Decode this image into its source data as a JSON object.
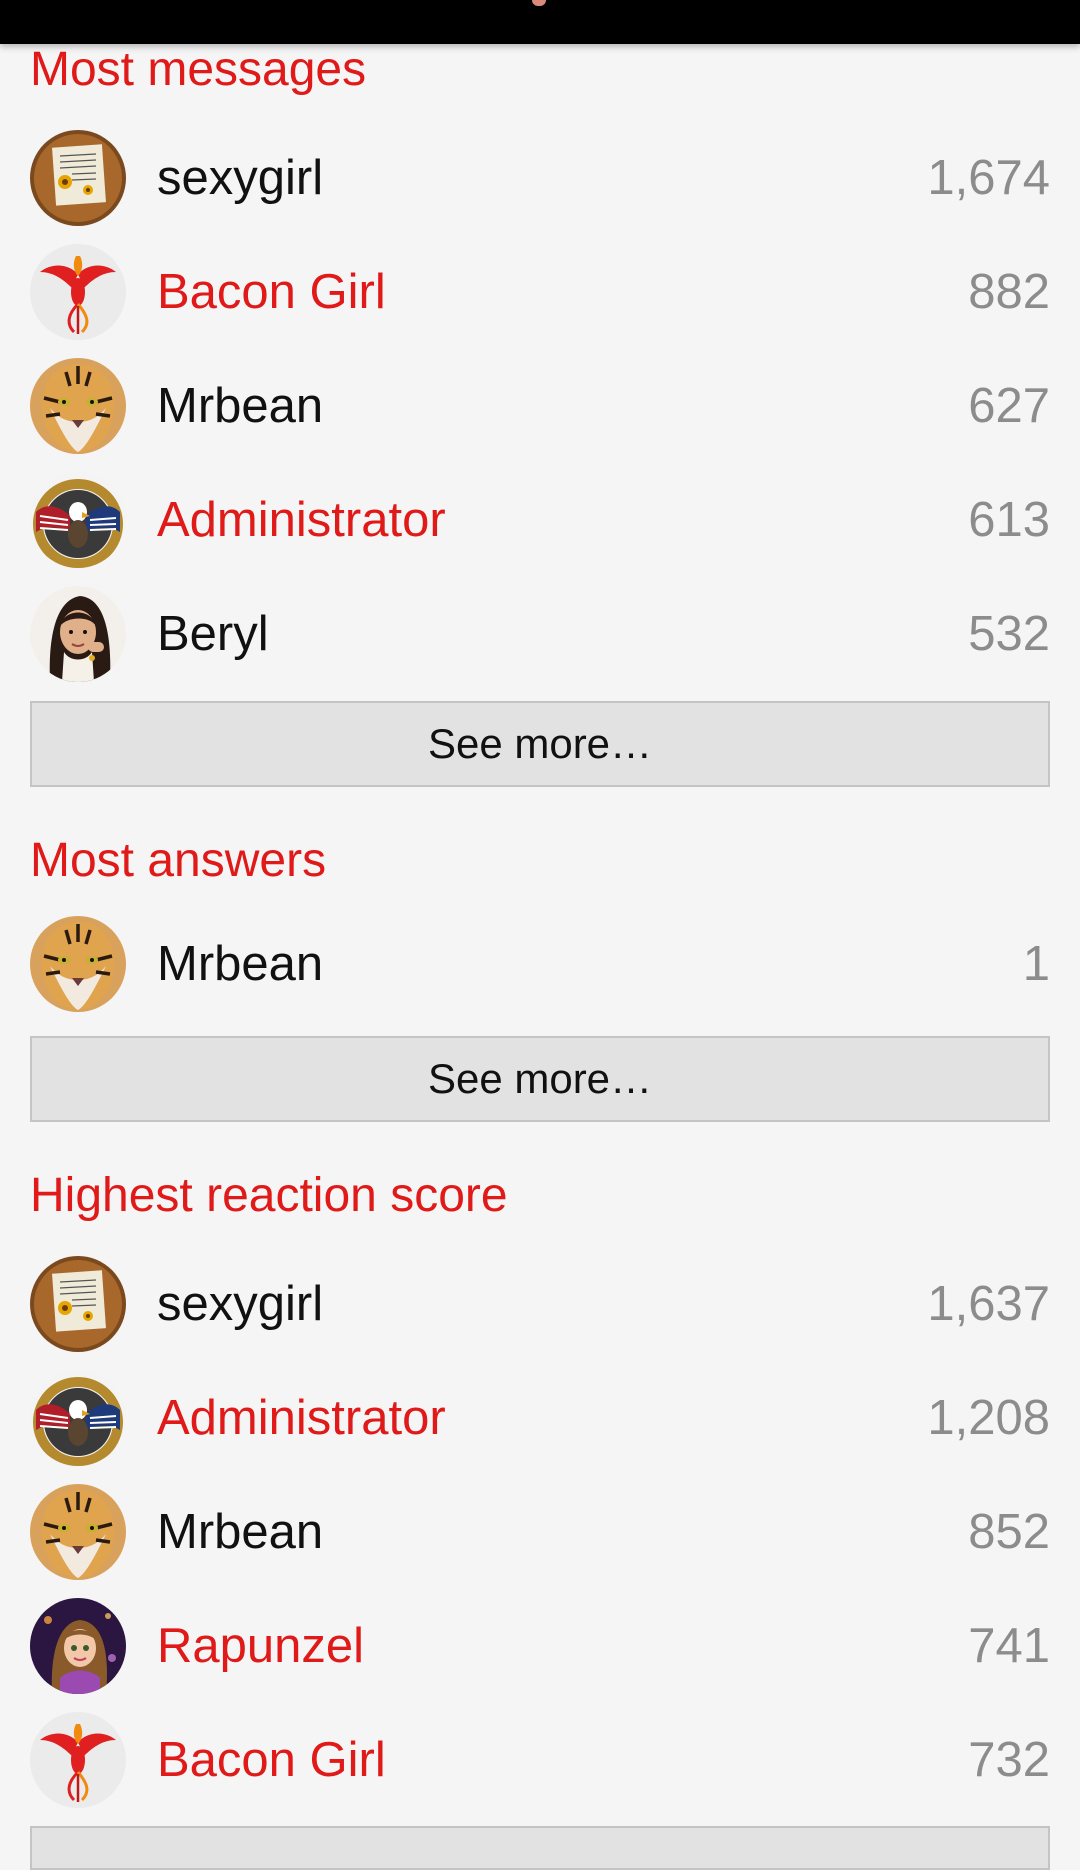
{
  "sections": [
    {
      "title": "Most messages",
      "members": [
        {
          "name": "sexygirl",
          "count": "1,674",
          "staff": false,
          "avatar": "sunflower-note-avatar"
        },
        {
          "name": "Bacon Girl",
          "count": "882",
          "staff": true,
          "avatar": "phoenix-avatar"
        },
        {
          "name": "Mrbean",
          "count": "627",
          "staff": false,
          "avatar": "tiger-avatar"
        },
        {
          "name": "Administrator",
          "count": "613",
          "staff": true,
          "avatar": "eagle-seal-avatar"
        },
        {
          "name": "Beryl",
          "count": "532",
          "staff": false,
          "avatar": "woman-portrait-avatar"
        }
      ],
      "see_more": "See more…"
    },
    {
      "title": "Most answers",
      "members": [
        {
          "name": "Mrbean",
          "count": "1",
          "staff": false,
          "avatar": "tiger-avatar"
        }
      ],
      "see_more": "See more…"
    },
    {
      "title": "Highest reaction score",
      "members": [
        {
          "name": "sexygirl",
          "count": "1,637",
          "staff": false,
          "avatar": "sunflower-note-avatar"
        },
        {
          "name": "Administrator",
          "count": "1,208",
          "staff": true,
          "avatar": "eagle-seal-avatar"
        },
        {
          "name": "Mrbean",
          "count": "852",
          "staff": false,
          "avatar": "tiger-avatar"
        },
        {
          "name": "Rapunzel",
          "count": "741",
          "staff": true,
          "avatar": "rapunzel-avatar"
        },
        {
          "name": "Bacon Girl",
          "count": "732",
          "staff": true,
          "avatar": "phoenix-avatar"
        }
      ]
    }
  ],
  "colors": {
    "accent": "#e01919",
    "text": "#111111",
    "count": "#8c8c8c",
    "background": "#f5f5f5",
    "button": "#e2e2e2"
  }
}
